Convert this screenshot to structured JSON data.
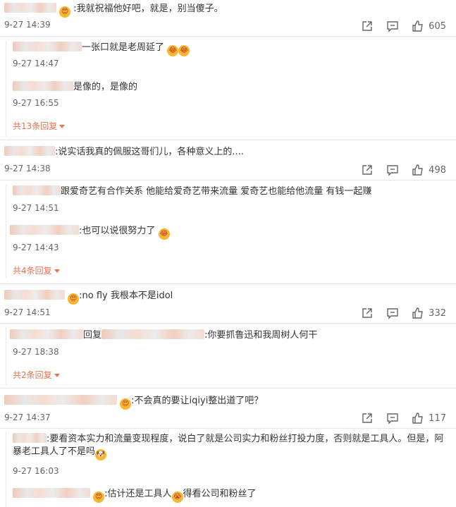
{
  "comments": [
    {
      "text": ":我就祝福他好吧，就是，别当傻子。",
      "time": "9-27 14:39",
      "likes": "605",
      "replies": [
        {
          "text": "一张口就是老周延了",
          "time": "9-27 14:47"
        },
        {
          "text": "是像的，是像的",
          "time": "9-27 16:55"
        }
      ],
      "more": "共13条回复"
    },
    {
      "text": ":说实话我真的佩服这哥们儿，各种意义上的....",
      "time": "9-27 14:38",
      "likes": "498",
      "replies": [
        {
          "text": "跟爱奇艺有合作关系 他能给爱奇艺带来流量 爱奇艺也能给他流量 有钱一起赚",
          "time": "9-27 14:51"
        },
        {
          "text": ":也可以说很努力了",
          "time": "9-27 14:43"
        }
      ],
      "more": "共4条回复"
    },
    {
      "text": ":no fly 我根本不是idol",
      "time": "9-27 14:51",
      "likes": "332",
      "replies": [
        {
          "prefix": "回复",
          "text": ":你要抓鲁迅和我周树人何干",
          "time": "9-27 18:38"
        }
      ],
      "more": "共2条回复"
    },
    {
      "text": ":不会真的要让iqiyi整出道了吧？",
      "time": "9-27 14:37",
      "likes": "117",
      "replies": [
        {
          "text": ":要看资本实力和流量变现程度，说白了就是公司实力和粉丝打投力度，否则就是工具人。但是，阿暴老工具人了不是吗",
          "time": "9-27 16:03"
        },
        {
          "text": ":估计还是工具人",
          "text2": "得看公司和粉丝了"
        }
      ]
    }
  ],
  "icons": {
    "share": "share-icon",
    "comment": "comment-icon",
    "like": "thumbs-up-icon",
    "expand": "caret-down-icon",
    "emoji": "emoji-icon"
  },
  "colors": {
    "link": "#eb7350",
    "text": "#333333",
    "meta": "#666666"
  }
}
